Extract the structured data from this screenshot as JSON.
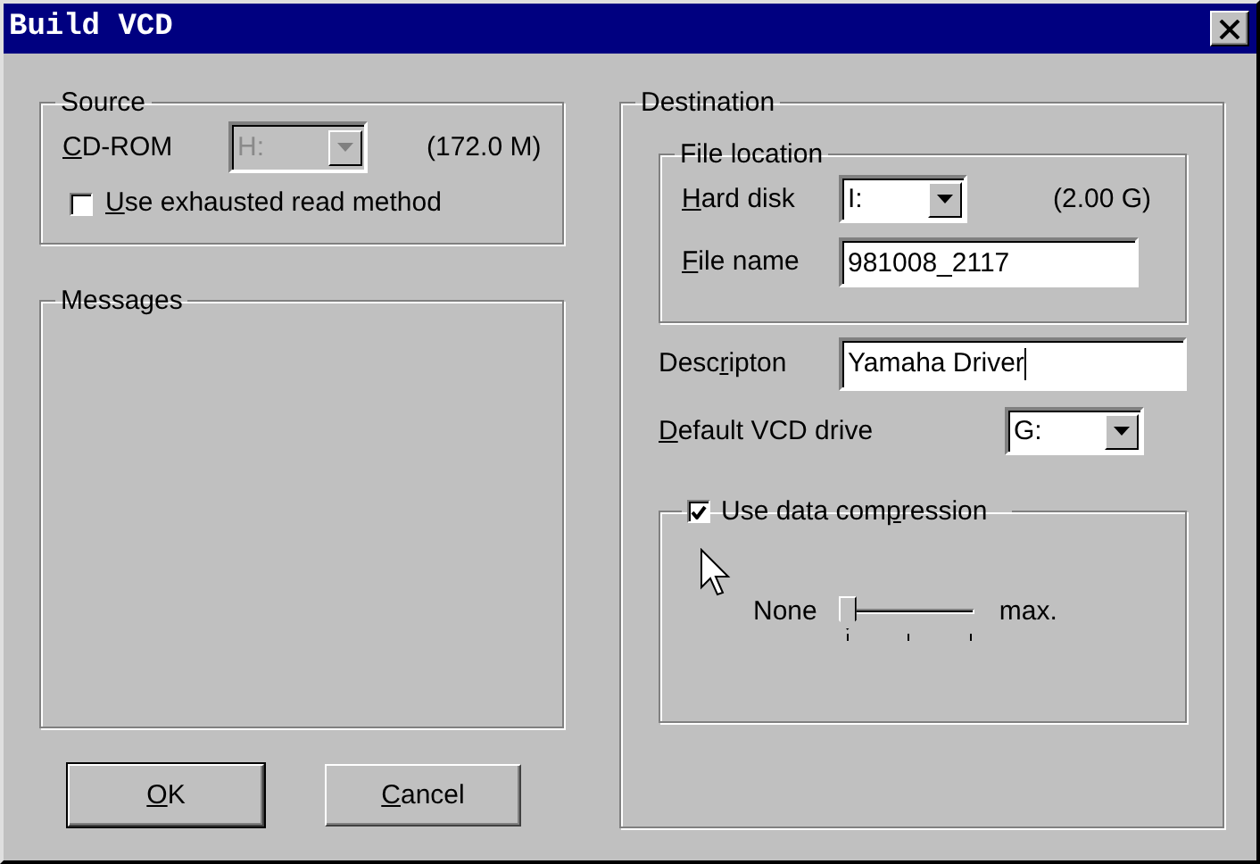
{
  "window": {
    "title": "Build VCD"
  },
  "source": {
    "title": "Source",
    "cdrom": {
      "label_parts": [
        {
          "text": "C",
          "underline": true
        },
        {
          "text": "D-ROM",
          "underline": false
        }
      ],
      "value": "H:",
      "disabled": true
    },
    "size": "(172.0 M)",
    "exhausted_read": {
      "label_parts": [
        {
          "text": "U",
          "underline": true
        },
        {
          "text": "se exhausted read method",
          "underline": false
        }
      ],
      "checked": false
    }
  },
  "messages": {
    "title": "Messages"
  },
  "buttons": [
    {
      "label_parts": [
        {
          "text": "O",
          "underline": true
        },
        {
          "text": "K",
          "underline": false
        }
      ],
      "default": true
    },
    {
      "label_parts": [
        {
          "text": "C",
          "underline": true
        },
        {
          "text": "ancel",
          "underline": false
        }
      ],
      "default": false
    }
  ],
  "destination": {
    "title": "Destination",
    "file_location": {
      "title": "File location",
      "hard_disk": {
        "label_parts": [
          {
            "text": "H",
            "underline": true
          },
          {
            "text": "ard disk",
            "underline": false
          }
        ],
        "value": "I:"
      },
      "size": "(2.00 G)",
      "file_name": {
        "label_parts": [
          {
            "text": "F",
            "underline": true
          },
          {
            "text": "ile name",
            "underline": false
          }
        ],
        "value": "981008_2117"
      }
    },
    "description": {
      "label_parts": [
        {
          "text": "Desc",
          "underline": false
        },
        {
          "text": "r",
          "underline": true
        },
        {
          "text": "ipton",
          "underline": false
        }
      ],
      "value": "Yamaha Driver"
    },
    "default_drive": {
      "label_parts": [
        {
          "text": "D",
          "underline": true
        },
        {
          "text": "efault VCD drive",
          "underline": false
        }
      ],
      "value": "G:"
    },
    "compression": {
      "label_parts": [
        {
          "text": "Use data com",
          "underline": false
        },
        {
          "text": "p",
          "underline": true
        },
        {
          "text": "ression",
          "underline": false
        }
      ],
      "checked": true,
      "min_label": "None",
      "max_label": "max.",
      "level": 0
    }
  }
}
